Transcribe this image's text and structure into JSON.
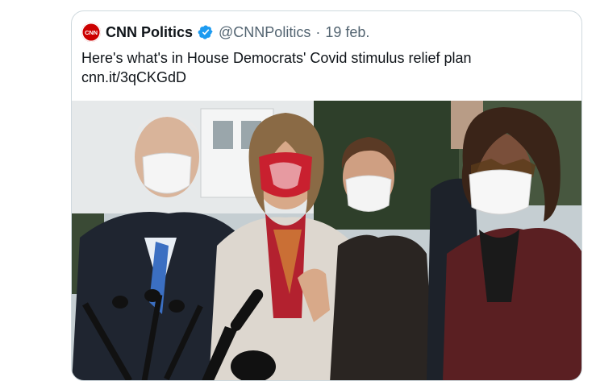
{
  "tweet": {
    "avatar_text": "CNN",
    "display_name": "CNN Politics",
    "handle": "@CNNPolitics",
    "separator": "·",
    "date": "19 feb.",
    "text": "Here's what's in House Democrats' Covid stimulus relief plan",
    "link": "cnn.it/3qCKGdD"
  },
  "colors": {
    "verified": "#1d9bf0",
    "brand": "#cc0000",
    "secondary_text": "#536471"
  },
  "icons": {
    "verified": "verified-badge-icon"
  }
}
